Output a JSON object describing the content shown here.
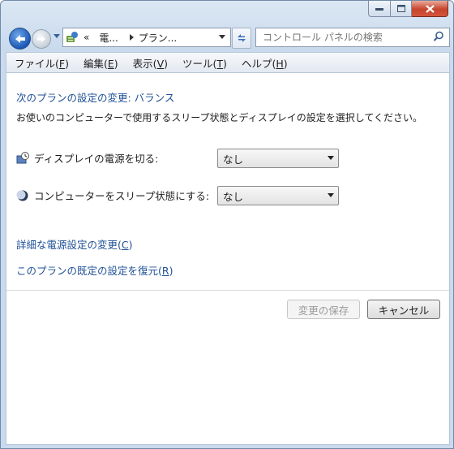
{
  "window": {
    "caption_buttons": [
      "minimize",
      "maximize",
      "close"
    ]
  },
  "nav": {
    "address_prefix": "«",
    "address_parts": [
      "電...",
      "プラン..."
    ],
    "search_placeholder": "コントロール パネルの検索"
  },
  "menu": {
    "items": [
      {
        "label": "ファイル(",
        "key": "F",
        "tail": ")"
      },
      {
        "label": "編集(",
        "key": "E",
        "tail": ")"
      },
      {
        "label": "表示(",
        "key": "V",
        "tail": ")"
      },
      {
        "label": "ツール(",
        "key": "T",
        "tail": ")"
      },
      {
        "label": "ヘルプ(",
        "key": "H",
        "tail": ")"
      }
    ]
  },
  "main": {
    "plan_title": "次のプランの設定の変更: バランス",
    "description": "お使いのコンピューターで使用するスリープ状態とディスプレイの設定を選択してください。",
    "display_off": {
      "label": "ディスプレイの電源を切る:",
      "value": "なし"
    },
    "sleep": {
      "label": "コンピューターをスリープ状態にする:",
      "value": "なし"
    },
    "advanced_link": {
      "label": "詳細な電源設定の変更(",
      "key": "C",
      "tail": ")"
    },
    "restore_link": {
      "label": "このプランの既定の設定を復元(",
      "key": "R",
      "tail": ")"
    }
  },
  "buttons": {
    "save": "変更の保存",
    "cancel": "キャンセル"
  },
  "colors": {
    "link": "#1e4f94",
    "back_button": "#1d58b6",
    "close_button": "#c7442c"
  }
}
